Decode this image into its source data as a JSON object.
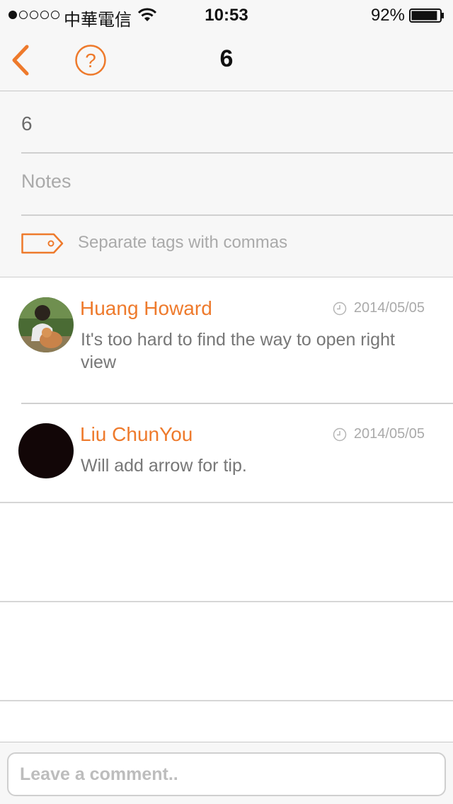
{
  "status_bar": {
    "carrier": "中華電信",
    "time": "10:53",
    "battery_percent": "92%",
    "signal_bars_filled": 1,
    "signal_bars_total": 5,
    "battery_level": 0.92
  },
  "nav": {
    "title": "6",
    "back_icon": "chevron-left-icon",
    "help_icon": "question-circle-icon",
    "accent_color": "#ee7a2c"
  },
  "form": {
    "title_value": "6",
    "notes_placeholder": "Notes",
    "tags_placeholder": "Separate tags with commas",
    "tag_icon": "tag-icon"
  },
  "comments": [
    {
      "author": "Huang Howard",
      "date": "2014/05/05",
      "text": "It's too hard to find the way to open right view"
    },
    {
      "author": "Liu ChunYou",
      "date": "2014/05/05",
      "text": "Will add arrow for tip."
    }
  ],
  "comment_input": {
    "placeholder": "Leave a comment.."
  }
}
